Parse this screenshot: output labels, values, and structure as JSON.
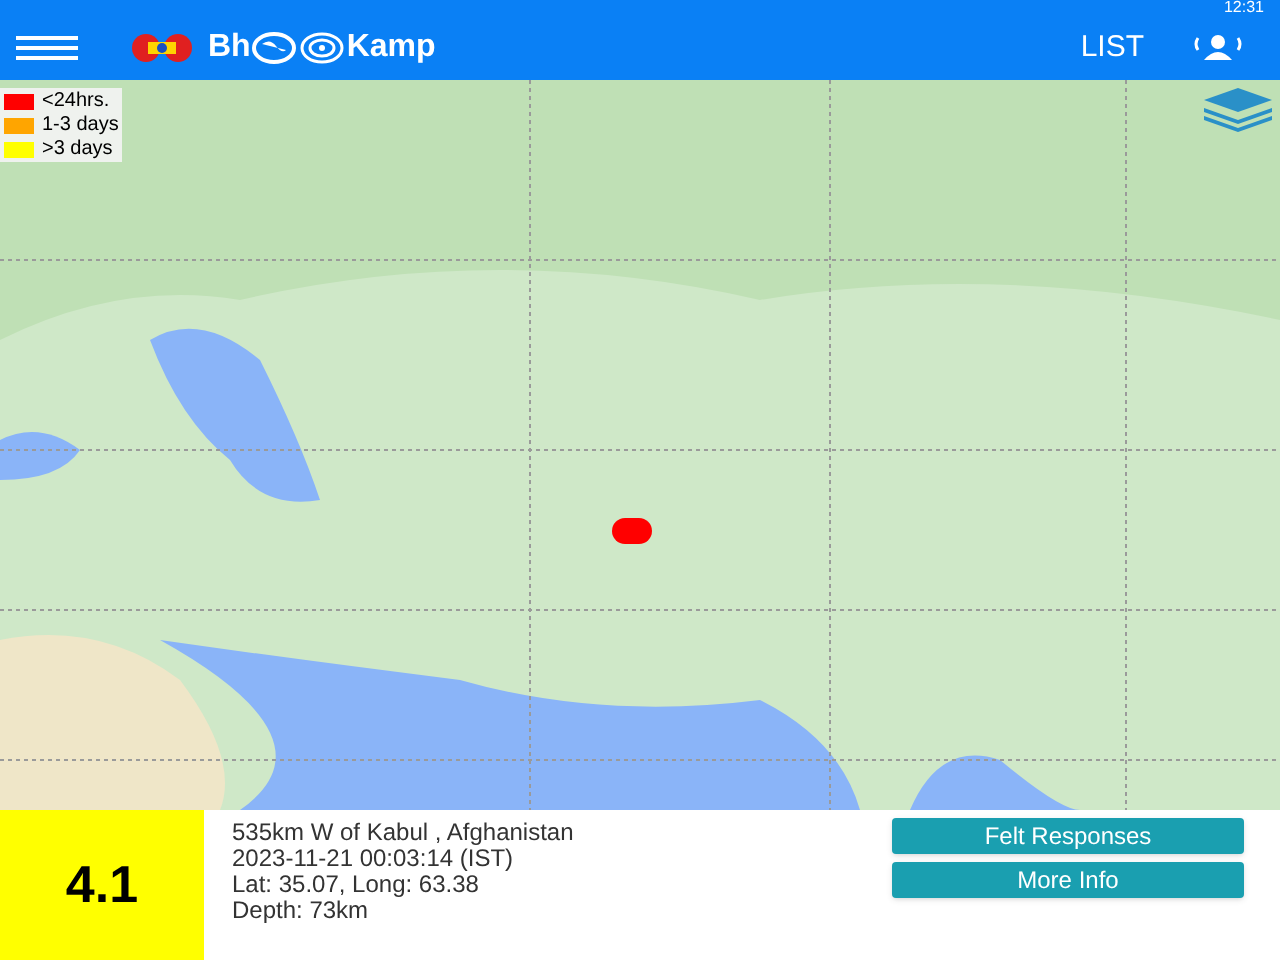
{
  "status_bar": {
    "time": "12:31"
  },
  "app_bar": {
    "logo_left": "Bh",
    "logo_right": "Kamp",
    "action": "LIST"
  },
  "legend": [
    {
      "label": "<24hrs.",
      "color": "#ff0000"
    },
    {
      "label": "1-3 days",
      "color": "#ffa500"
    },
    {
      "label": ">3 days",
      "color": "#ffff00"
    }
  ],
  "map": {
    "markers": [
      {
        "color": "#ff0000"
      }
    ]
  },
  "quake": {
    "magnitude": "4.1",
    "color": "#ffff00",
    "place": "535km W of Kabul , Afghanistan",
    "time": "2023-11-21 00:03:14 (IST)",
    "coords": "Lat: 35.07, Long: 63.38",
    "depth": "Depth: 73km"
  },
  "buttons": [
    "Felt Responses",
    "More Info"
  ]
}
